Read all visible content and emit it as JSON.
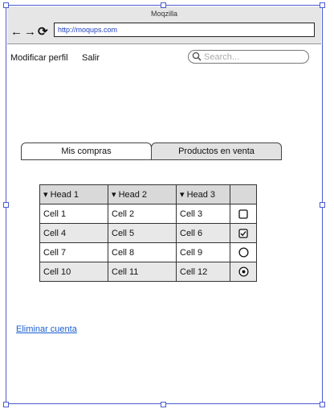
{
  "window": {
    "title": "Moqzilla",
    "url": "http://moqups.com"
  },
  "nav_icons": [
    "arrow-left-icon",
    "arrow-right-icon",
    "reload-icon"
  ],
  "menu": {
    "profile_label": "Modificar perfil",
    "logout_label": "Salir"
  },
  "search": {
    "placeholder": "Search..."
  },
  "tabs": [
    {
      "label": "Mis compras",
      "active": true
    },
    {
      "label": "Productos en venta",
      "active": false
    }
  ],
  "table": {
    "headers": [
      "▾ Head 1",
      "▾ Head 2",
      "▾ Head 3",
      ""
    ],
    "rows": [
      {
        "cells": [
          "Cell 1",
          "Cell 2",
          "Cell 3"
        ],
        "control": "checkbox",
        "checked": false
      },
      {
        "cells": [
          "Cell 4",
          "Cell 5",
          "Cell 6"
        ],
        "control": "checkbox",
        "checked": true
      },
      {
        "cells": [
          "Cell 7",
          "Cell 8",
          "Cell 9"
        ],
        "control": "radio",
        "checked": false
      },
      {
        "cells": [
          "Cell 10",
          "Cell 11",
          "Cell 12"
        ],
        "control": "radio",
        "checked": true
      }
    ]
  },
  "delete_account_label": "Eliminar cuenta",
  "colors": {
    "selection": "#4a5bd0",
    "link": "#1a5fd0",
    "header_bg": "#d9d9d9",
    "alt_row_bg": "#e8e8e8"
  }
}
